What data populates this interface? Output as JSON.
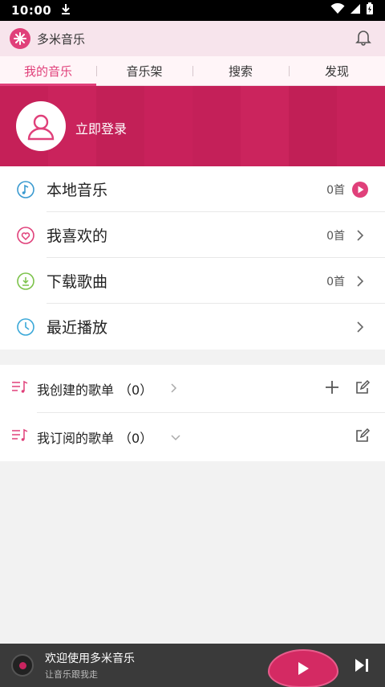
{
  "status_bar": {
    "time": "10:00"
  },
  "app": {
    "name": "多米音乐",
    "brand_color": "#e0407a"
  },
  "tabs": [
    {
      "label": "我的音乐",
      "active": true
    },
    {
      "label": "音乐架",
      "active": false
    },
    {
      "label": "搜索",
      "active": false
    },
    {
      "label": "发现",
      "active": false
    }
  ],
  "banner": {
    "login_text": "立即登录",
    "overlay_color": "#ce205c"
  },
  "menu": {
    "items": [
      {
        "label": "本地音乐",
        "count": "0首",
        "icon": "music-note-icon",
        "trail": "play-circle-icon"
      },
      {
        "label": "我喜欢的",
        "count": "0首",
        "icon": "heart-icon",
        "trail": "chevron-right-icon"
      },
      {
        "label": "下载歌曲",
        "count": "0首",
        "icon": "download-icon",
        "trail": "chevron-right-icon"
      },
      {
        "label": "最近播放",
        "count": "",
        "icon": "clock-icon",
        "trail": "chevron-right-icon"
      }
    ]
  },
  "playlists": {
    "created": {
      "label": "我创建的歌单",
      "count": "（0）"
    },
    "subscribed": {
      "label": "我订阅的歌单",
      "count": "（0）"
    }
  },
  "player": {
    "title": "欢迎使用多米音乐",
    "subtitle": "让音乐跟我走"
  }
}
